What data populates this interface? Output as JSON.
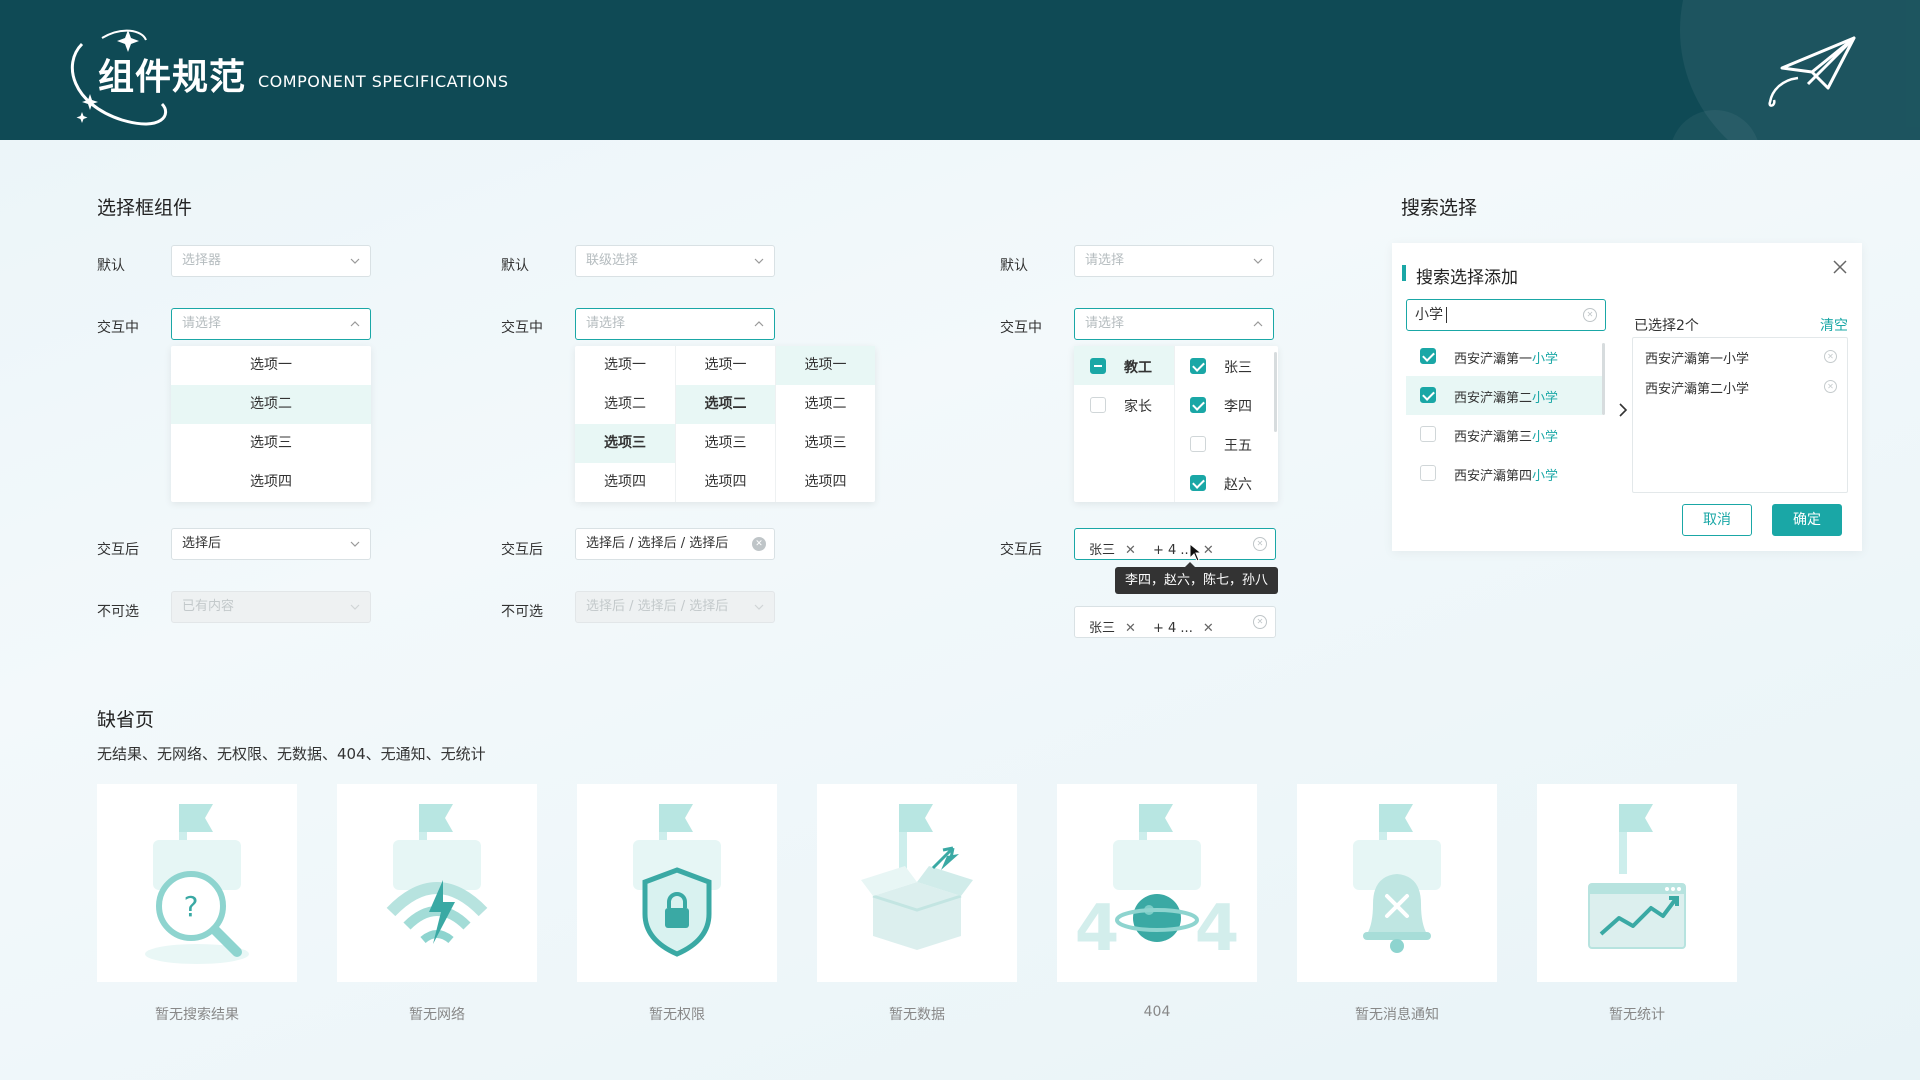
{
  "header": {
    "title": "组件规范",
    "subtitle": "COMPONENT SPECIFICATIONS"
  },
  "select_section": {
    "title": "选择框组件",
    "labels": {
      "default": "默认",
      "active": "交互中",
      "after": "交互后",
      "disabled": "不可选"
    },
    "basic": {
      "default_placeholder": "选择器",
      "active_placeholder": "请选择",
      "options": [
        "选项一",
        "选项二",
        "选项三",
        "选项四"
      ],
      "after_value": "选择后",
      "disabled_value": "已有内容"
    },
    "cascade": {
      "default_placeholder": "联级选择",
      "active_placeholder": "请选择",
      "col1": [
        "选项一",
        "选项二",
        "选项三",
        "选项四"
      ],
      "col2": [
        "选项一",
        "选项二",
        "选项三",
        "选项四"
      ],
      "col3": [
        "选项一",
        "选项二",
        "选项三",
        "选项四"
      ],
      "after_value": "选择后 / 选择后 / 选择后",
      "disabled_value": "选择后 / 选择后 / 选择后"
    },
    "multi": {
      "default_placeholder": "请选择",
      "active_placeholder": "请选择",
      "groups": [
        "教工",
        "家长"
      ],
      "people": [
        "张三",
        "李四",
        "王五",
        "赵六"
      ],
      "tag1": "张三",
      "more": "+ 4 ...",
      "tooltip": "李四，赵六，陈七，孙八",
      "tag2": "张三",
      "more2": "+ 4 ..."
    }
  },
  "search_section": {
    "title": "搜索选择",
    "panel_title": "搜索选择添加",
    "query": "小学",
    "results": [
      {
        "prefix": "西安浐灞第一",
        "match": "小学",
        "checked": true
      },
      {
        "prefix": "西安浐灞第二",
        "match": "小学",
        "checked": true
      },
      {
        "prefix": "西安浐灞第三",
        "match": "小学",
        "checked": false
      },
      {
        "prefix": "西安浐灞第四",
        "match": "小学",
        "checked": false
      }
    ],
    "chosen_head": "已选择2个",
    "clear_label": "清空",
    "chosen": [
      "西安浐灞第一小学",
      "西安浐灞第二小学"
    ],
    "cancel_label": "取消",
    "ok_label": "确定"
  },
  "empty_section": {
    "title": "缺省页",
    "desc": "无结果、无网络、无权限、无数据、404、无通知、无统计",
    "cards": [
      "暂无搜索结果",
      "暂无网络",
      "暂无权限",
      "暂无数据",
      "404",
      "暂无消息通知",
      "暂无统计"
    ]
  },
  "colors": {
    "banner": "#0f4a55",
    "accent": "#1aa7a6",
    "illustration": "#8ed4cf"
  }
}
